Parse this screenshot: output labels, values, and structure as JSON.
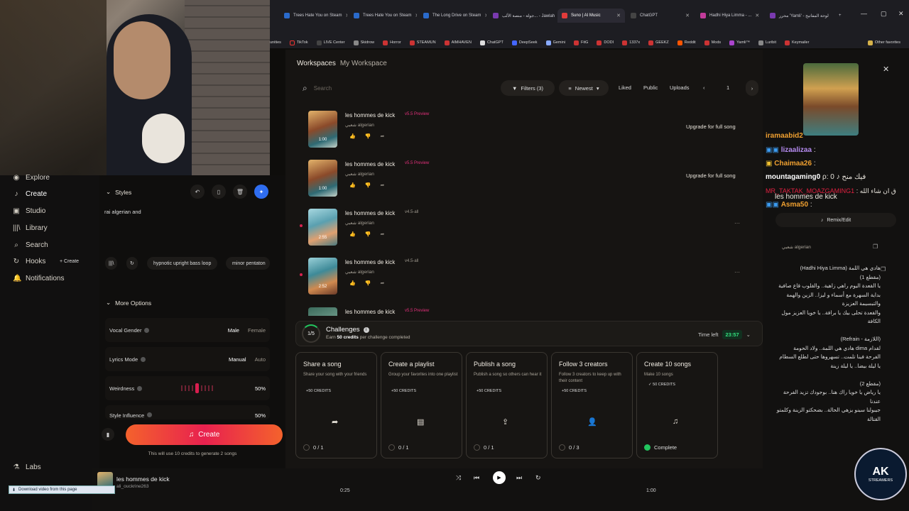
{
  "browser": {
    "tabs": [
      {
        "label": "Trees Hate You on Steam",
        "color": "#2a6acb"
      },
      {
        "label": "Trees Hate You on Steam",
        "color": "#2a6acb"
      },
      {
        "label": "The Long Drive on Steam",
        "color": "#2a6acb"
      },
      {
        "label": "جولة - منصة الألب... - Jawlah",
        "color": "#7a3ab0"
      },
      {
        "label": "Suno | AI Music",
        "color": "#e23b3b",
        "active": true
      },
      {
        "label": "ChatGPT",
        "color": "#444"
      },
      {
        "label": "Hadhi Hiya Limma - ...",
        "color": "#c23b9a"
      },
      {
        "label": "محرر 'Yamli' - لوحة المفاتيح",
        "color": "#7a3ab0"
      }
    ],
    "new_tab": "+",
    "bookmarks": [
      "unities",
      "TikTok",
      "LIVE Center",
      "Skidrow",
      "Horror",
      "STEAMUN",
      "AIMHAVEN",
      "ChatGPT",
      "DeepSeek",
      "Gemini",
      "FitG",
      "DODI",
      "1337x",
      "GEEKZ",
      "Reddit",
      "Mods",
      "Yamli™",
      "Luribit",
      "Keymailer"
    ],
    "other_favorites": "Other favorites"
  },
  "nav": {
    "items": [
      "Explore",
      "Create",
      "Studio",
      "Library",
      "Search",
      "Hooks",
      "Notifications"
    ],
    "glyphs": [
      "◉",
      "♪",
      "▣",
      "|||\\",
      "⌕",
      "↻",
      "🔔"
    ],
    "hooks_create": "+ Create",
    "labs": "Labs"
  },
  "create": {
    "styles_label": "Styles",
    "styles_text": "rai algerian and",
    "chips": [
      "hypnotic upright bass loop",
      "minor pentaton"
    ],
    "more_options": "More Options",
    "vocal_gender": {
      "label": "Vocal Gender",
      "options": [
        "Male",
        "Female"
      ],
      "selected": "Male"
    },
    "lyrics_mode": {
      "label": "Lyrics Mode",
      "options": [
        "Manual",
        "Auto"
      ],
      "selected": "Manual"
    },
    "weirdness": {
      "label": "Weirdness",
      "value": "50%",
      "level": 0.5
    },
    "style_influence": {
      "label": "Style Influence",
      "value": "50%",
      "level": 0.5
    },
    "create_button": "Create",
    "credits_note": "This will use 10 credits to generate 2 songs"
  },
  "workspace": {
    "breadcrumb_root": "Workspaces",
    "breadcrumb_current": "My Workspace",
    "search_placeholder": "Search",
    "filters": "Filters (3)",
    "sort": "Newest",
    "liked": "Liked",
    "public": "Public",
    "uploads": "Uploads",
    "page": "1",
    "songs": [
      {
        "title": "les hommes de kick",
        "tag": "v5.5 Preview",
        "tag_color": "#e0307a",
        "genre": "شعبي algerian",
        "duration": "1:00",
        "upgrade": "Upgrade for full song"
      },
      {
        "title": "les hommes de kick",
        "tag": "v5.5 Preview",
        "tag_color": "#e0307a",
        "genre": "شعبي algerian",
        "duration": "1:00",
        "upgrade": "Upgrade for full song"
      },
      {
        "title": "les hommes de kick",
        "tag": "v4.5-all",
        "tag_color": "#9c968c",
        "genre": "شعبي algerian",
        "duration": "2:55",
        "upgrade": ""
      },
      {
        "title": "les hommes de kick",
        "tag": "v4.5-all",
        "tag_color": "#9c968c",
        "genre": "شعبي algerian",
        "duration": "2:52",
        "upgrade": ""
      },
      {
        "title": "les hommes de kick",
        "tag": "v5.5 Preview",
        "tag_color": "#e0307a",
        "genre": "",
        "duration": "",
        "upgrade": ""
      }
    ]
  },
  "challenges": {
    "progress": "1/5",
    "title": "Challenges",
    "subtitle_pre": "Earn",
    "subtitle_bold": "50 credits",
    "subtitle_post": "per challenge completed",
    "time_left_label": "Time left",
    "time_left": "23:57",
    "cards": [
      {
        "title": "Share a song",
        "desc": "Share your song with your friends",
        "credits": "+50 CREDITS",
        "icon": "➦",
        "progress": "0 / 1",
        "done": false
      },
      {
        "title": "Create a playlist",
        "desc": "Group your favorites into one playlist",
        "credits": "+50 CREDITS",
        "icon": "▤",
        "progress": "0 / 1",
        "done": false
      },
      {
        "title": "Publish a song",
        "desc": "Publish a song so others can hear it",
        "credits": "+50 CREDITS",
        "icon": "⇪",
        "progress": "0 / 1",
        "done": false
      },
      {
        "title": "Follow 3 creators",
        "desc": "Follow 3 creators to keep up with their content",
        "credits": "+50 CREDITS",
        "icon": "👤",
        "progress": "0 / 3",
        "done": false
      },
      {
        "title": "Create 10 songs",
        "desc": "Make 10 songs",
        "credits": "✓ 50 CREDITS",
        "icon": "♫",
        "progress": "Complete",
        "done": true
      }
    ]
  },
  "right_panel": {
    "close": "✕",
    "chat": [
      {
        "user": "iramaabid2",
        "text": "",
        "color": "#f0a030"
      },
      {
        "user": "lizaalizaa",
        "text": ":",
        "color": "#b58bf0"
      },
      {
        "user": "Chaimaa26",
        "text": ":",
        "color": "#f0a030"
      },
      {
        "user": "mountagaming0",
        "text": "ρ: فيك منح ♪ 0",
        "color": "#ffffff"
      },
      {
        "user": "MR_TAKTAK_MOAZGAMING1",
        "text": ": ق ان شاء الله",
        "color": "#e02040"
      },
      {
        "user": "Asma50",
        "text": ":",
        "color": "#f0a030"
      }
    ],
    "song_title": "les hommes de kick",
    "remix": "Remix/Edit",
    "genre": "شعبي algerian",
    "lyrics": "هادي هي اللمة (Hadhi Hiya Limma)\n(مقطع 1)\nيا القعدة اليوم راهي زاهية.. والقلوب قاع صافية\nبداية السهرة مع أسماء و ليزا.. الزين والهمة والتبسيمة العزيزة\nوالقعدة تحلى بيك يا برافة.. يا خويا العزيز مول الكافة\n\n(اللازمة - Refrain)\nلقدام dima هادي هي اللمة.. ولاد الحومة\nالفرحة فينا تلمت.. تسهروها حتى لطلع السطام\nيا ليلة بيضا.. يا ليلة زينة\n\n(مقطع 2)\nيا رياض يا خويا راك هنا.. بوجودك تزيد الفرحة عندنا\nجيبولنا سينو يزهي الحالة.. بضحكتو الزينة وكلمتو القتالة",
    "logo_main": "AK",
    "logo_sub": "STREAMERS"
  },
  "player": {
    "title": "les hommes de kick",
    "artist": "ali_ouckrine263",
    "time_elapsed": "0:25",
    "time_total": "1:00"
  },
  "download_bar": "Download video from this page"
}
